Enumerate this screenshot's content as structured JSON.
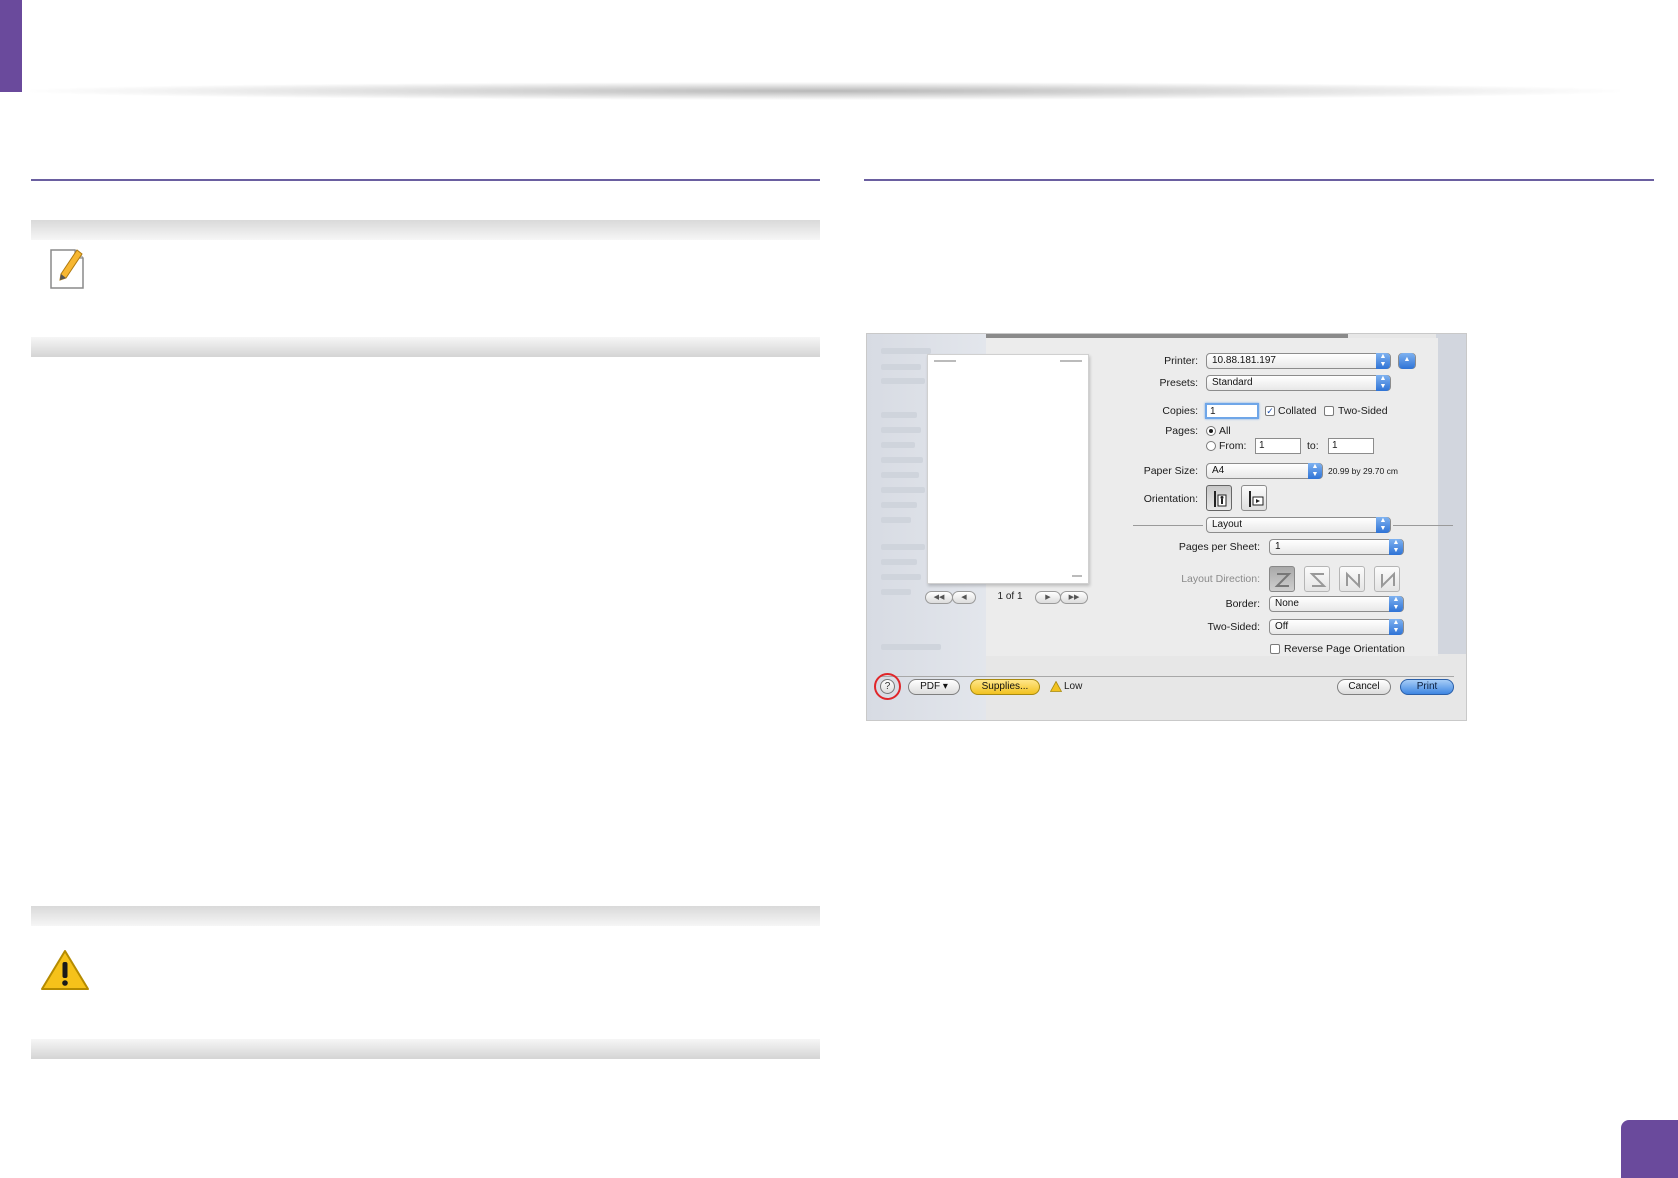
{
  "dialog": {
    "printer": {
      "label": "Printer:",
      "value": "10.88.181.197"
    },
    "presets": {
      "label": "Presets:",
      "value": "Standard"
    },
    "copies": {
      "label": "Copies:",
      "value": "1",
      "collated": "Collated",
      "two_sided": "Two-Sided"
    },
    "pages": {
      "label": "Pages:",
      "all": "All",
      "from": "From:",
      "from_value": "1",
      "to": "to:",
      "to_value": "1"
    },
    "paper_size": {
      "label": "Paper Size:",
      "value": "A4",
      "dimensions": "20.99 by 29.70 cm"
    },
    "orientation": {
      "label": "Orientation:"
    },
    "section": "Layout",
    "pages_per_sheet": {
      "label": "Pages per Sheet:",
      "value": "1"
    },
    "layout_direction": {
      "label": "Layout Direction:"
    },
    "border": {
      "label": "Border:",
      "value": "None"
    },
    "two_sided_setting": {
      "label": "Two-Sided:",
      "value": "Off"
    },
    "reverse_orientation": "Reverse Page Orientation",
    "preview_nav": {
      "first": "◀◀",
      "prev": "◀",
      "page": "1 of 1",
      "next": "▶",
      "last": "▶▶"
    },
    "footer": {
      "help": "?",
      "pdf": "PDF ▾",
      "supplies": "Supplies...",
      "supplies_status": "Low",
      "cancel": "Cancel",
      "print": "Print"
    }
  },
  "colors": {
    "accent": "#6a4a9c",
    "rule": "#6a5fa0",
    "highlight_ring": "#e0262a"
  },
  "icons": {
    "note": "note-pencil-icon",
    "caution": "warning-triangle-icon"
  }
}
